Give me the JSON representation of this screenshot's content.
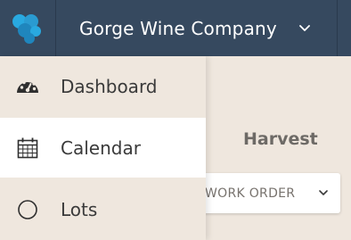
{
  "header": {
    "company_name": "Gorge Wine Company",
    "logo_icon": "grape-cluster-icon",
    "chevron_icon": "chevron-down-icon",
    "bar_color": "#36495f",
    "logo_color": "#29a9e0"
  },
  "nav": {
    "items": [
      {
        "label": "Dashboard",
        "icon": "speedometer-icon",
        "active": false
      },
      {
        "label": "Calendar",
        "icon": "calendar-icon",
        "active": true
      },
      {
        "label": "Lots",
        "icon": "circle-icon",
        "active": false
      }
    ]
  },
  "page": {
    "heading": "Harvest",
    "work_order_label": "WORK ORDER",
    "work_order_chevron": "chevron-down-icon"
  }
}
